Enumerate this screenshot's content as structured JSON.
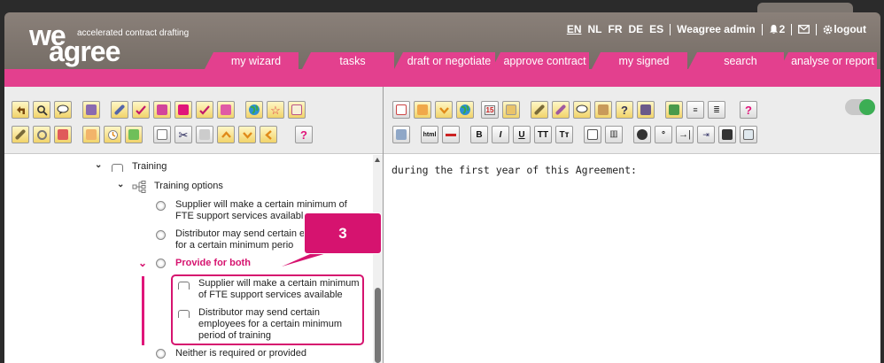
{
  "logo": {
    "word_top": "we",
    "word_bottom": "agree",
    "tagline": "accelerated contract drafting"
  },
  "topbar": {
    "languages": [
      "EN",
      "NL",
      "FR",
      "DE",
      "ES"
    ],
    "active_language": "EN",
    "user": "Weagree admin",
    "notification_count": "2",
    "logout": "logout"
  },
  "tabs": [
    "my wizard",
    "tasks",
    "draft or negotiate",
    "approve contract",
    "my signed",
    "search",
    "analyse or report"
  ],
  "tree": {
    "training": "Training",
    "training_options": "Training options",
    "option1_line1": "Supplier will make a certain minimum of",
    "option1_line2": "FTE support services availabl",
    "option2_line1": "Distributor may send certain e",
    "option2_line2": "for a certain minimum perio",
    "provide_both": "Provide for both",
    "sub1_line1": "Supplier will make a certain minimum",
    "sub1_line2": "of FTE support services available",
    "sub2_line1": "Distributor may send certain",
    "sub2_line2": "employees for a certain minimum",
    "sub2_line3": "period of training",
    "neither": "Neither is required or provided"
  },
  "callout": {
    "number": "3"
  },
  "editor": {
    "text": "during the first year of this Agreement:"
  },
  "toolbar_right_labels": {
    "html": "html",
    "bold": "B",
    "italic": "I",
    "underline": "U",
    "tt": "TT",
    "tt_small": "Tт",
    "degree": "°"
  },
  "colors": {
    "accent_pink": "#e3408e",
    "highlight": "#d6136f",
    "header": "#7d7670",
    "toggle_on": "#3cae54"
  }
}
